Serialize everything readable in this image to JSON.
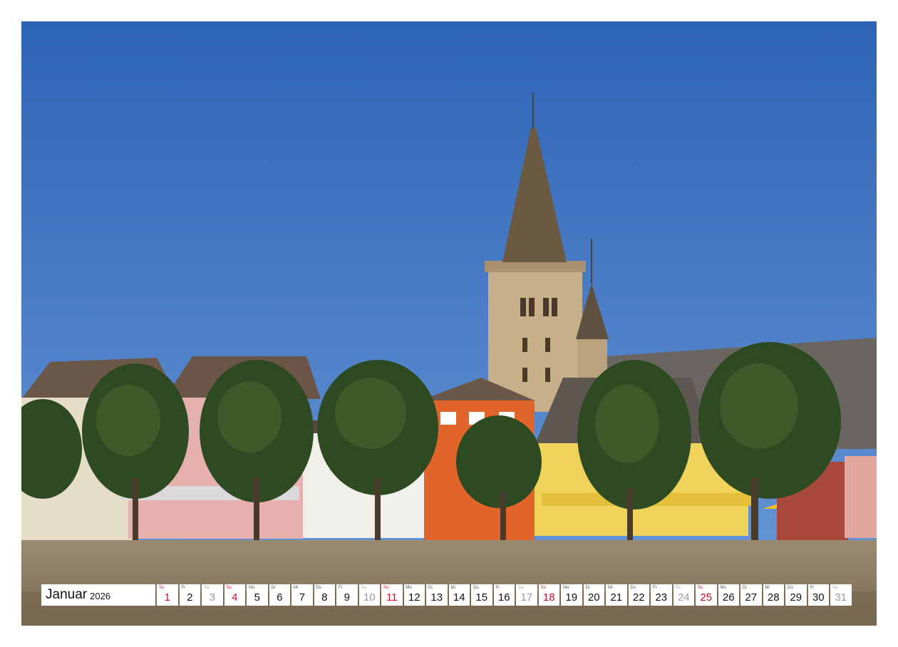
{
  "calendar": {
    "month": "Januar",
    "year": "2026",
    "days": [
      {
        "wd": "So",
        "n": "1",
        "t": "sun"
      },
      {
        "wd": "Fr",
        "n": "2",
        "t": ""
      },
      {
        "wd": "Sa",
        "n": "3",
        "t": "sat"
      },
      {
        "wd": "So",
        "n": "4",
        "t": "sun"
      },
      {
        "wd": "Mo",
        "n": "5",
        "t": ""
      },
      {
        "wd": "Di",
        "n": "6",
        "t": ""
      },
      {
        "wd": "Mi",
        "n": "7",
        "t": ""
      },
      {
        "wd": "Do",
        "n": "8",
        "t": ""
      },
      {
        "wd": "Fr",
        "n": "9",
        "t": ""
      },
      {
        "wd": "Sa",
        "n": "10",
        "t": "sat"
      },
      {
        "wd": "So",
        "n": "11",
        "t": "sun"
      },
      {
        "wd": "Mo",
        "n": "12",
        "t": ""
      },
      {
        "wd": "Di",
        "n": "13",
        "t": ""
      },
      {
        "wd": "Mi",
        "n": "14",
        "t": ""
      },
      {
        "wd": "Do",
        "n": "15",
        "t": ""
      },
      {
        "wd": "Fr",
        "n": "16",
        "t": ""
      },
      {
        "wd": "Sa",
        "n": "17",
        "t": "sat"
      },
      {
        "wd": "So",
        "n": "18",
        "t": "sun"
      },
      {
        "wd": "Mo",
        "n": "19",
        "t": ""
      },
      {
        "wd": "Di",
        "n": "20",
        "t": ""
      },
      {
        "wd": "Mi",
        "n": "21",
        "t": ""
      },
      {
        "wd": "Do",
        "n": "22",
        "t": ""
      },
      {
        "wd": "Fr",
        "n": "23",
        "t": ""
      },
      {
        "wd": "Sa",
        "n": "24",
        "t": "sat"
      },
      {
        "wd": "So",
        "n": "25",
        "t": "sun"
      },
      {
        "wd": "Mo",
        "n": "26",
        "t": ""
      },
      {
        "wd": "Di",
        "n": "27",
        "t": ""
      },
      {
        "wd": "Mi",
        "n": "28",
        "t": ""
      },
      {
        "wd": "Do",
        "n": "29",
        "t": ""
      },
      {
        "wd": "Fr",
        "n": "30",
        "t": ""
      },
      {
        "wd": "Sa",
        "n": "31",
        "t": "sat"
      }
    ]
  },
  "colors": {
    "sunday": "#c8102e",
    "saturday": "#9a9a9a",
    "sky_top": "#2f66b8",
    "sky_bottom": "#5a8ed3"
  }
}
